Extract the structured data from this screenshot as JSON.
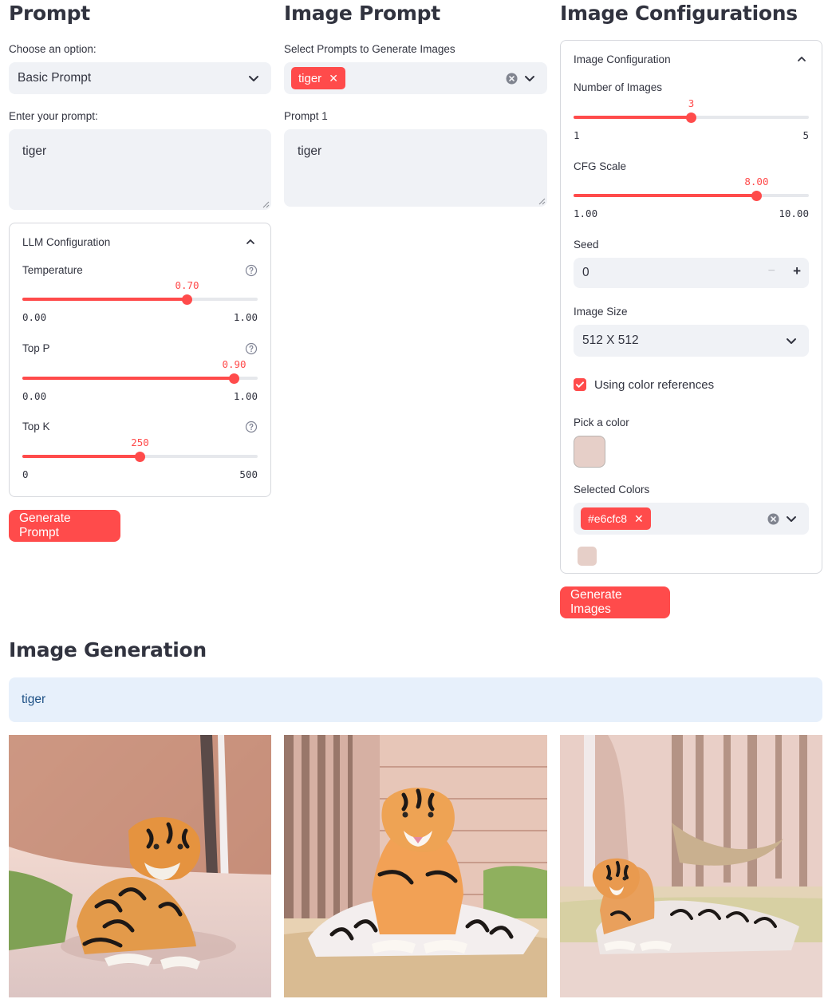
{
  "col1": {
    "title": "Prompt",
    "choose_label": "Choose an option:",
    "choose_value": "Basic Prompt",
    "prompt_label": "Enter your prompt:",
    "prompt_value": "tiger",
    "llm": {
      "title": "LLM Configuration",
      "temperature": {
        "label": "Temperature",
        "value": "0.70",
        "min": "0.00",
        "max": "1.00",
        "fraction": 0.7
      },
      "top_p": {
        "label": "Top P",
        "value": "0.90",
        "min": "0.00",
        "max": "1.00",
        "fraction": 0.9
      },
      "top_k": {
        "label": "Top K",
        "value": "250",
        "min": "0",
        "max": "500",
        "fraction": 0.5
      }
    },
    "generate_button": "Generate Prompt"
  },
  "col2": {
    "title": "Image Prompt",
    "select_label": "Select Prompts to Generate Images",
    "selected_tag": "tiger",
    "prompt1_label": "Prompt 1",
    "prompt1_value": "tiger"
  },
  "col3": {
    "title": "Image Configurations",
    "config_title": "Image Configuration",
    "num_images": {
      "label": "Number of Images",
      "value": "3",
      "min": "1",
      "max": "5",
      "fraction": 0.5
    },
    "cfg_scale": {
      "label": "CFG Scale",
      "value": "8.00",
      "min": "1.00",
      "max": "10.00",
      "fraction": 0.7778
    },
    "seed": {
      "label": "Seed",
      "value": "0"
    },
    "image_size": {
      "label": "Image Size",
      "value": "512 X 512"
    },
    "color_refs": {
      "label": "Using color references",
      "checked": true
    },
    "pick_color_label": "Pick a color",
    "picked_color": "#e6cfc8",
    "selected_colors_label": "Selected Colors",
    "selected_color_tag": "#e6cfc8",
    "generate_button": "Generate Images"
  },
  "generation": {
    "title": "Image Generation",
    "info_text": "tiger",
    "images": [
      "tiger-on-path-by-rocks",
      "tiger-on-stone-ledge",
      "tiger-in-forest-clearing"
    ]
  },
  "colors": {
    "accent": "#ff4b4b",
    "input_bg": "#f0f2f6",
    "info_bg": "#e7f0fb",
    "info_text": "#1c4f84"
  }
}
